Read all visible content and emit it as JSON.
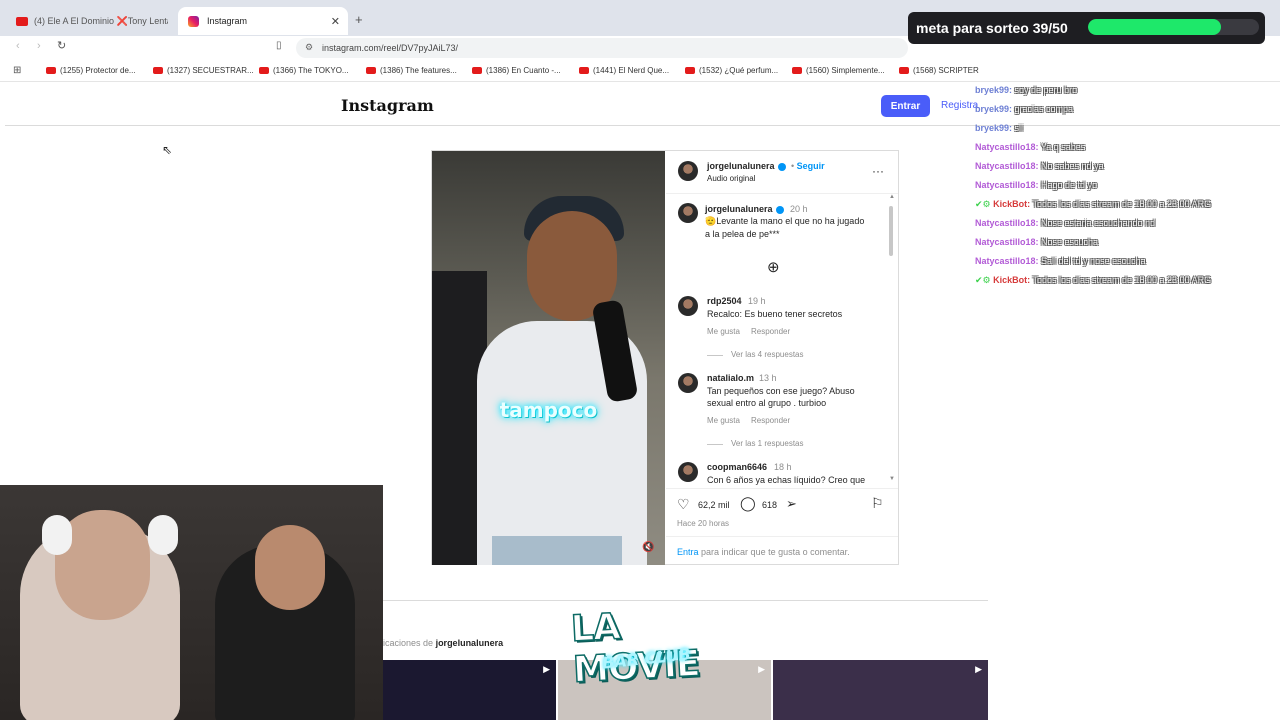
{
  "browser": {
    "tabs": [
      {
        "label": "(4) Ele A El Dominio ❌Tony Lenta -",
        "active": false
      },
      {
        "label": "Instagram",
        "active": true
      }
    ],
    "url": "instagram.com/reel/DV7pyJAiL73/",
    "bookmarks": [
      "(1255) Protector de...",
      "(1327) SECUESTRAR...",
      "(1366) The TOKYO...",
      "(1386) The features...",
      "(1386) En Cuanto -...",
      "(1441) El Nerd Que...",
      "(1532) ¿Qué perfum...",
      "(1560) Simplemente...",
      "(1568) SCRIPTER"
    ]
  },
  "instagram": {
    "logo": "Instagram",
    "login_button": "Entrar",
    "register_link": "Registra",
    "post": {
      "author": "jorgelunalunera",
      "follow": "Seguir",
      "audio": "Audio original",
      "video_caption": "tampoco",
      "caption_author": "jorgelunalunera",
      "caption_time": "20 h",
      "caption_line1": "🫡Levante la mano el que no ha jugado",
      "caption_line2": "a la pelea de pe***",
      "comments": [
        {
          "user": "rdp2504",
          "time": "19 h",
          "text": "Recalco: Es bueno tener secretos",
          "like": "Me gusta",
          "reply": "Responder",
          "replies": "Ver las 4 respuestas"
        },
        {
          "user": "natalialo.m",
          "time": "13 h",
          "text1": "Tan pequeños con ese juego? Abuso",
          "text2": "sexual entro al grupo . turbioo",
          "like": "Me gusta",
          "reply": "Responder",
          "replies": "Ver las 1 respuestas"
        },
        {
          "user": "coopman6646",
          "time": "18 h",
          "text": "Con 6 años ya echas líquido? Creo que"
        }
      ],
      "likes": "62,2 mil",
      "comment_count": "618",
      "posted": "Hace 20 horas",
      "login_prompt_link": "Entra",
      "login_prompt_text": "para indicar que te gusta o comentar."
    },
    "more_from_prefix": "icaciones de",
    "more_from_user": "jorgelunalunera"
  },
  "stream": {
    "goal_text": "meta para sorteo 39/50",
    "goal_progress": 0.78,
    "logo_main": "LA MOVIE",
    "logo_sub": "BAR CLUB",
    "chat": [
      {
        "user": "bryek99:",
        "msg": "soy de peru bro",
        "color": "blue"
      },
      {
        "user": "bryek99:",
        "msg": "gracias compa",
        "color": "blue"
      },
      {
        "user": "bryek99:",
        "msg": "sii",
        "color": "blue"
      },
      {
        "user": "Natycastillo18:",
        "msg": "Ya q sabes",
        "color": "purple"
      },
      {
        "user": "Natycastillo18:",
        "msg": "No sabes nd ya",
        "color": "purple"
      },
      {
        "user": "Natycastillo18:",
        "msg": "Hago de td yo",
        "color": "purple"
      },
      {
        "user": "KickBot:",
        "msg": "Todos los dias stream de 18:00 a 23:00 ARG",
        "color": "bot"
      },
      {
        "user": "Natycastillo18:",
        "msg": "Nose estaria escuchando nd",
        "color": "purple"
      },
      {
        "user": "Natycastillo18:",
        "msg": "Nose escucha",
        "color": "purple"
      },
      {
        "user": "Natycastillo18:",
        "msg": "Sali del td y nose escucha",
        "color": "purple"
      },
      {
        "user": "KickBot:",
        "msg": "Todos los dias stream de 18:00 a 23:00 ARG",
        "color": "bot"
      }
    ]
  }
}
